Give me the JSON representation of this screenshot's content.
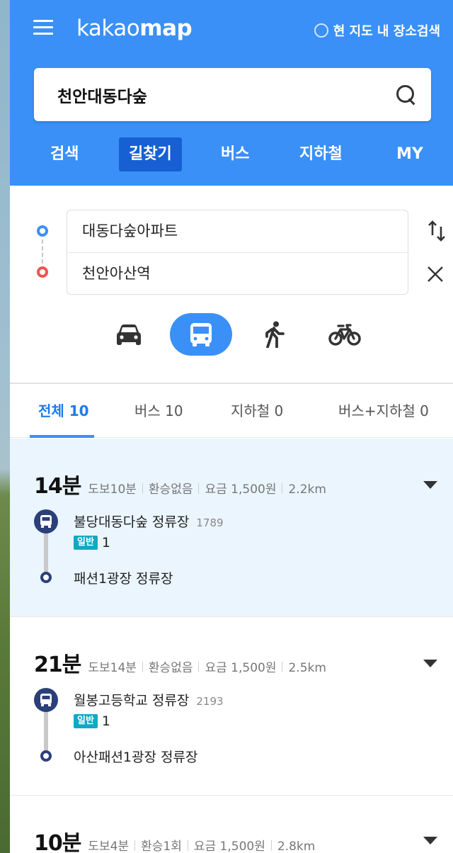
{
  "header": {
    "logo_light": "kakao",
    "logo_bold": "map",
    "loc_search_label": "현 지도 내 장소검색",
    "search_value": "천안대동다숲",
    "tabs": [
      "검색",
      "길찾기",
      "버스",
      "지하철",
      "MY"
    ],
    "active_tab": "길찾기",
    "accent": "#3a90f7"
  },
  "route": {
    "origin": "대동다숲아파트",
    "destination": "천안아산역",
    "modes": [
      "car-icon",
      "bus-icon",
      "walk-icon",
      "bicycle-icon"
    ],
    "active_mode": "bus"
  },
  "result_tabs": [
    "전체 10",
    "버스 10",
    "지하철 0",
    "버스+지하철 0"
  ],
  "results": [
    {
      "time": "14분",
      "walk": "도보10분",
      "transfer": "환승없음",
      "fare": "요금 1,500원",
      "distance": "2.2km",
      "board_stop": "불당대동다숲 정류장",
      "board_stop_id": "1789",
      "bus_type": "일반",
      "bus_no": "1",
      "alight_stop": "패션1광장 정류장"
    },
    {
      "time": "21분",
      "walk": "도보14분",
      "transfer": "환승없음",
      "fare": "요금 1,500원",
      "distance": "2.5km",
      "board_stop": "월봉고등학교 정류장",
      "board_stop_id": "2193",
      "bus_type": "일반",
      "bus_no": "1",
      "alight_stop": "아산패션1광장 정류장"
    },
    {
      "time": "10분",
      "walk": "도보4분",
      "transfer": "환승1회",
      "fare": "요금 1,500원",
      "distance": "2.8km"
    }
  ]
}
